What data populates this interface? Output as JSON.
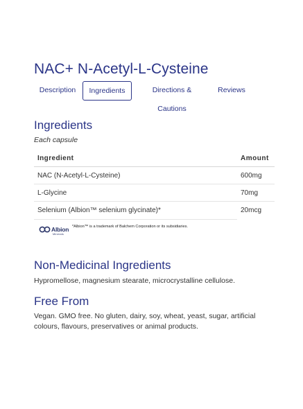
{
  "product": {
    "title": "NAC+ N-Acetyl-L-Cysteine"
  },
  "tabs": [
    {
      "label": "Description"
    },
    {
      "label": "Ingredients",
      "active": true
    },
    {
      "label": "Directions & Cautions"
    },
    {
      "label": "Reviews"
    }
  ],
  "ingredients": {
    "title": "Ingredients",
    "subtitle": "Each capsule",
    "header": {
      "ingredient": "Ingredient",
      "amount": "Amount"
    },
    "rows": [
      {
        "name": "NAC (N-Acetyl-L-Cysteine)",
        "amount": "600mg"
      },
      {
        "name": "L-Glycine",
        "amount": "70mg"
      },
      {
        "name": "Selenium (Albion™ selenium glycinate)*",
        "amount": "20mcg"
      }
    ],
    "albion": {
      "brand": "Albion",
      "brand_sub": "Minerals",
      "note": "*Albion™ is a trademark of Balchem Corporation or its subsidiaries."
    }
  },
  "non_medicinal": {
    "title": "Non-Medicinal Ingredients",
    "text": "Hypromellose, magnesium stearate, microcrystalline cellulose."
  },
  "free_from": {
    "title": "Free From",
    "text": "Vegan. GMO free. No gluten, dairy, soy, wheat, yeast, sugar, artificial colours, flavours, preservatives or animal products."
  },
  "colors": {
    "accent": "#2a3487",
    "text": "#333333",
    "divider": "#e4e4e4"
  }
}
